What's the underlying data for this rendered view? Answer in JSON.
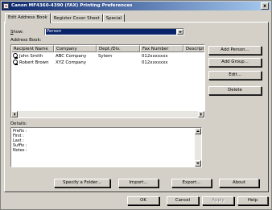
{
  "window": {
    "title": "Canon MF4360-4390 (FAX) Printing Preferences",
    "close_glyph": "x"
  },
  "tabs": [
    {
      "label": "Edit Address Book",
      "active": true
    },
    {
      "label": "Register Cover Sheet",
      "active": false
    },
    {
      "label": "Special",
      "active": false
    }
  ],
  "show": {
    "label_prefix": "S",
    "label_rest": "how:",
    "selected": "Person"
  },
  "address_book": {
    "label": "Address Book:",
    "columns": [
      "Recipient Name",
      "Company",
      "Dept./Div.",
      "Fax Number",
      "Description"
    ],
    "rows": [
      {
        "name": "John Smith",
        "company": "ABC Company",
        "dept": "Sytem",
        "fax": "012xxxxxxx",
        "description": ""
      },
      {
        "name": "Robert Brown",
        "company": "XYZ Company",
        "dept": "",
        "fax": "012xxxxxxx",
        "description": ""
      }
    ]
  },
  "side_buttons": {
    "add_person": "Add Person...",
    "add_group": "Add Group...",
    "edit": "Edit...",
    "delete": "Delete"
  },
  "details": {
    "label": "Details:",
    "lines": [
      "Prefix :",
      "First  :",
      "Last  :",
      "Suffix :",
      "Notes :"
    ]
  },
  "bottom_buttons": {
    "specify_folder": "Specify a Folder...",
    "import": "Import...",
    "export": "Export...",
    "about": "About"
  },
  "dialog_buttons": {
    "ok": "OK",
    "cancel": "Cancel",
    "apply": "Apply",
    "help": "Help"
  }
}
